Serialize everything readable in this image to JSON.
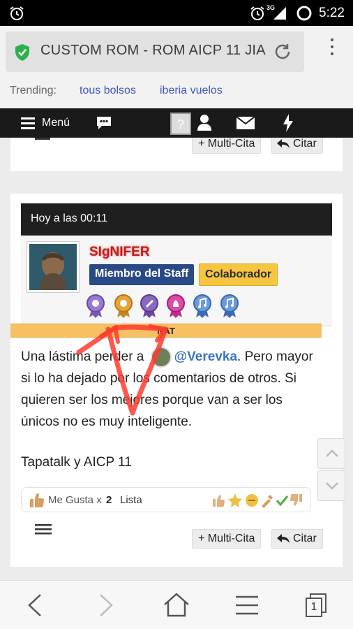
{
  "status_bar": {
    "time": "5:22",
    "network": "3G"
  },
  "browser": {
    "url": "CUSTOM ROM - ROM AICP 11 JIA",
    "trending_label": "Trending:",
    "trending": [
      "tous bolsos",
      "iberia vuelos"
    ]
  },
  "forum_nav": {
    "menu_label": "Menú"
  },
  "prev_post": {
    "multiquote": "+ Multi-Cita",
    "quote": "Citar"
  },
  "post": {
    "timestamp": "Hoy a las 00:11",
    "username": "SIgNIFER",
    "badge_staff": "Miembro del Staff",
    "badge_collab": "Colaborador",
    "nat_label": "NAT",
    "message_before_mention": "Una lástima perder a",
    "mention": "@Verevka",
    "message_after_mention": ". Pero mayor si lo ha dejado por los comentarios de otros. Si quieren ser los mejores porque van a ser los únicos no es muy inteligente.",
    "signature": "Tapatalk y AICP 11",
    "likes_label": "Me Gusta x",
    "likes_count": "2",
    "likes_list": "Lista",
    "multiquote": "+ Multi-Cita",
    "quote": "Citar"
  },
  "colors": {
    "staff_badge": "#2a4a86",
    "collab_badge": "#f7c640",
    "username": "#c21a1a",
    "mention": "#3a73c4",
    "nat_bar": "#f6c063"
  },
  "bottom_nav": {
    "tab_count": "1"
  }
}
